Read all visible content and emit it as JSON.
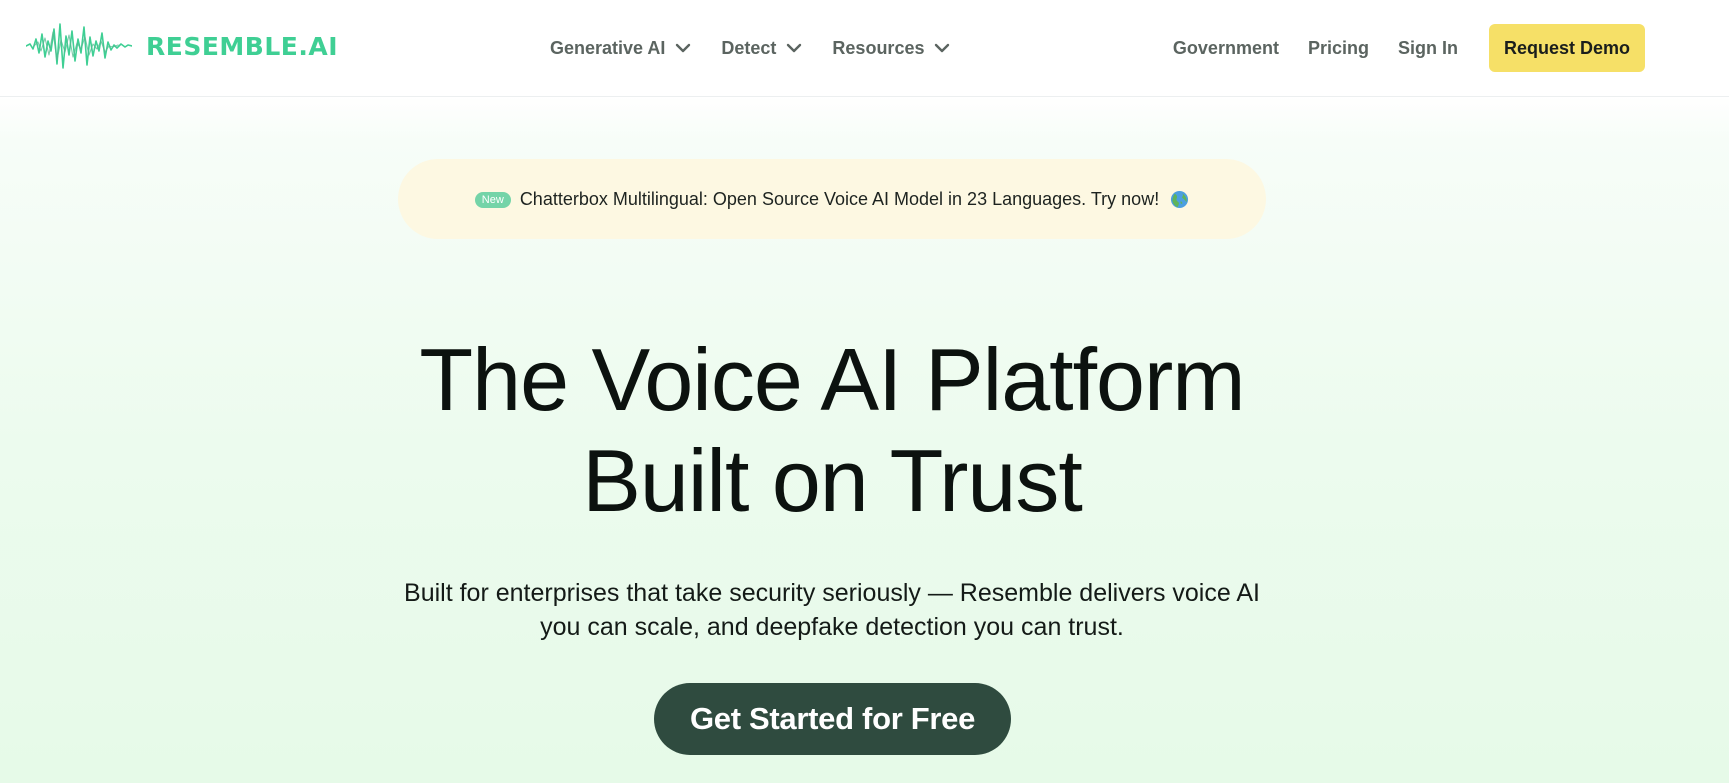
{
  "header": {
    "logo": {
      "text": "RESEMBLE.AI",
      "icon": "waveform-logo-icon",
      "color": "#3fcf94"
    },
    "nav": [
      {
        "label": "Generative AI",
        "icon": "chevron-down-icon"
      },
      {
        "label": "Detect",
        "icon": "chevron-down-icon"
      },
      {
        "label": "Resources",
        "icon": "chevron-down-icon"
      }
    ],
    "links": {
      "government": "Government",
      "pricing": "Pricing",
      "sign_in": "Sign In"
    },
    "demo_button": {
      "label": "Request Demo",
      "color": "#f6e067"
    }
  },
  "announcement": {
    "badge": "New",
    "text": "Chatterbox Multilingual: Open Source Voice AI Model in 23 Languages. Try now!",
    "icon": "globe-icon",
    "background": "#fdf8e2"
  },
  "hero": {
    "title_lines": [
      "The Voice AI Platform",
      "Built on Trust"
    ],
    "subtitle_lines": [
      "Built for enterprises that take security seriously — Resemble delivers voice AI",
      "you can scale, and deepfake detection you can trust."
    ],
    "cta": {
      "label": "Get Started for Free",
      "color": "#2f4b3f"
    }
  }
}
